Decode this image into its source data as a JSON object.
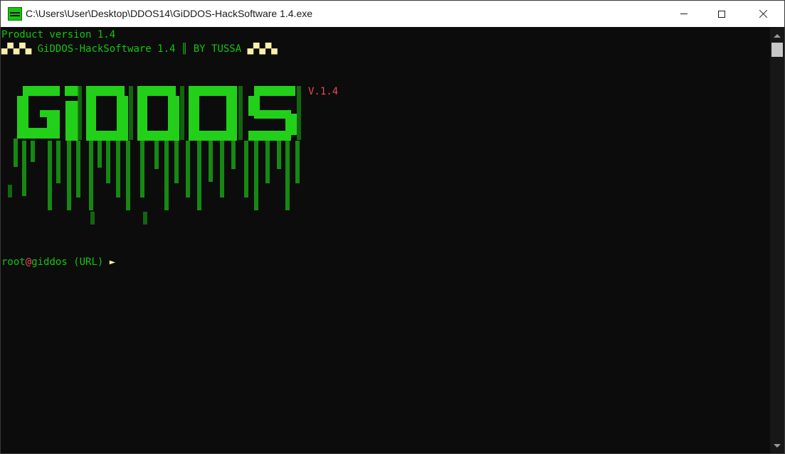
{
  "window": {
    "title": "C:\\Users\\User\\Desktop\\DDOS14\\GiDDOS-HackSoftware 1.4.exe",
    "app_icon": "console-app-icon",
    "controls": {
      "minimize": "minimize-icon",
      "maximize": "maximize-icon",
      "close": "close-icon"
    }
  },
  "console": {
    "product_version": "Product version 1.4",
    "banner": {
      "left_deco": "▄▀▄▀▄",
      "text": " GiDDOS-HackSoftware 1.4 ║ BY TUSSA ",
      "right_deco": "▄▀▄▀▄"
    },
    "logo_text": "GiDDOS",
    "version_tag": "V.1.4",
    "prompt": {
      "user": "root",
      "at": "@",
      "host": "giddos",
      "hint": " (URL) ",
      "arrow": "►"
    }
  },
  "colors": {
    "background": "#0c0c0c",
    "green": "#13c40e",
    "yellow": "#f9f1a5",
    "red": "#e74856"
  }
}
